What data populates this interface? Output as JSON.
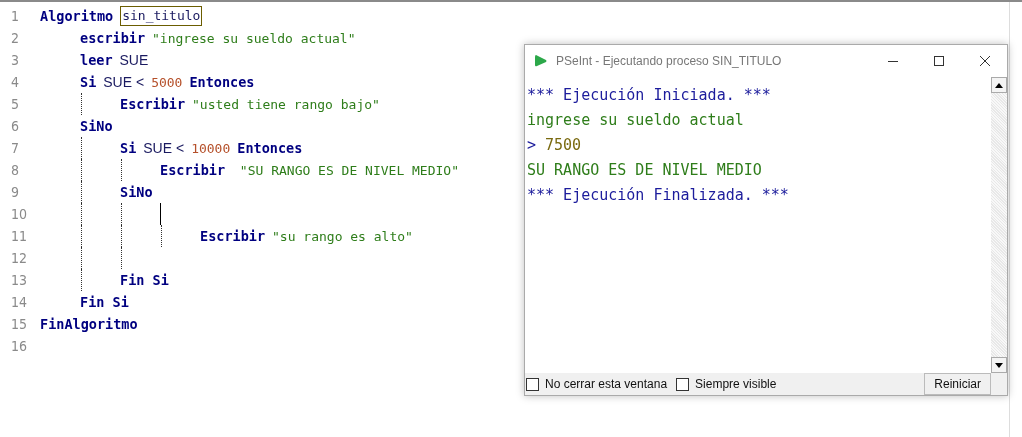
{
  "editor": {
    "lines": [
      {
        "number": "1",
        "caret": false,
        "tokens": [
          {
            "kind": "keyword",
            "text": "Algoritmo"
          },
          {
            "kind": "match",
            "text": "sin_titulo"
          }
        ],
        "children": [
          {
            "number": "2",
            "caret": false,
            "tokens": [
              {
                "kind": "keyword",
                "text": "escribir"
              },
              {
                "kind": "string",
                "text": "\"ingrese su sueldo actual\""
              }
            ]
          },
          {
            "number": "3",
            "caret": false,
            "tokens": [
              {
                "kind": "keyword",
                "text": "leer"
              },
              {
                "kind": "plain",
                "text": "SUE"
              }
            ]
          },
          {
            "number": "4",
            "caret": false,
            "tokens": [
              {
                "kind": "keyword",
                "text": "Si"
              },
              {
                "kind": "plain",
                "text": "SUE <"
              },
              {
                "kind": "number",
                "text": "5000"
              },
              {
                "kind": "keyword",
                "text": "Entonces"
              }
            ],
            "children": [
              {
                "number": "5",
                "caret": false,
                "tokens": [
                  {
                    "kind": "keyword",
                    "text": "Escribir"
                  },
                  {
                    "kind": "string",
                    "text": "\"usted tiene rango bajo\""
                  }
                ]
              }
            ]
          },
          {
            "number": "6",
            "caret": false,
            "tokens": [
              {
                "kind": "keyword",
                "text": "SiNo"
              }
            ],
            "children": [
              {
                "number": "7",
                "caret": false,
                "tokens": [
                  {
                    "kind": "keyword",
                    "text": "Si"
                  },
                  {
                    "kind": "plain",
                    "text": "SUE <"
                  },
                  {
                    "kind": "number",
                    "text": "10000"
                  },
                  {
                    "kind": "keyword",
                    "text": "Entonces"
                  }
                ],
                "children": [
                  {
                    "number": "8",
                    "caret": false,
                    "tokens": [
                      {
                        "kind": "keyword",
                        "text": "Escribir"
                      },
                      {
                        "kind": "string",
                        "text": " \"SU RANGO ES DE NIVEL MEDIO\""
                      }
                    ]
                  }
                ]
              },
              {
                "number": "9",
                "caret": false,
                "tokens": [
                  {
                    "kind": "keyword",
                    "text": "SiNo"
                  }
                ],
                "children": [
                  {
                    "number": "10",
                    "caret": true,
                    "children": [
                      {
                        "number": "11",
                        "caret": false,
                        "tokens": [
                          {
                            "kind": "keyword",
                            "text": "Escribir"
                          },
                          {
                            "kind": "string",
                            "text": "\"su rango es alto\""
                          }
                        ]
                      }
                    ]
                  },
                  {
                    "number": "12",
                    "caret": false
                  }
                ]
              },
              {
                "number": "13",
                "caret": false,
                "tokens": [
                  {
                    "kind": "keyword",
                    "text": "Fin Si"
                  }
                ]
              }
            ]
          },
          {
            "number": "14",
            "caret": false,
            "tokens": [
              {
                "kind": "keyword",
                "text": "Fin Si"
              }
            ]
          }
        ]
      },
      {
        "number": "15",
        "caret": false,
        "tokens": [
          {
            "kind": "keyword",
            "text": "FinAlgoritmo"
          }
        ]
      },
      {
        "number": "16",
        "caret": false
      }
    ]
  },
  "console": {
    "title": "PSeInt - Ejecutando proceso SIN_TITULO",
    "lines": [
      {
        "kind": "info",
        "text": "*** Ejecución Iniciada. ***"
      },
      {
        "kind": "output",
        "text": "ingrese su sueldo actual"
      },
      {
        "kind": "input",
        "prompt": ">",
        "text": "7500"
      },
      {
        "kind": "output",
        "text": "SU RANGO ES DE NIVEL MEDIO"
      },
      {
        "kind": "info",
        "text": "*** Ejecución Finalizada. ***"
      }
    ],
    "options": [
      {
        "label": "No cerrar esta ventana",
        "checked": false
      },
      {
        "label": "Siempre visible",
        "checked": false
      }
    ],
    "restart_button": "Reiniciar"
  }
}
